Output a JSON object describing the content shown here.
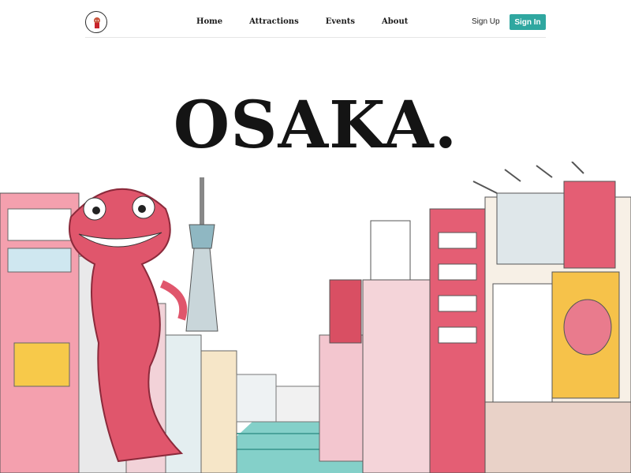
{
  "nav": {
    "links": [
      "Home",
      "Attractions",
      "Events",
      "About"
    ],
    "signup": "Sign Up",
    "signin": "Sign In"
  },
  "hero": {
    "title": "OSAKA."
  },
  "colors": {
    "accent": "#2fa7a0",
    "monster": "#e0566c",
    "canal": "#6fc8c0"
  },
  "icons": [
    "logo-mascot-icon"
  ]
}
